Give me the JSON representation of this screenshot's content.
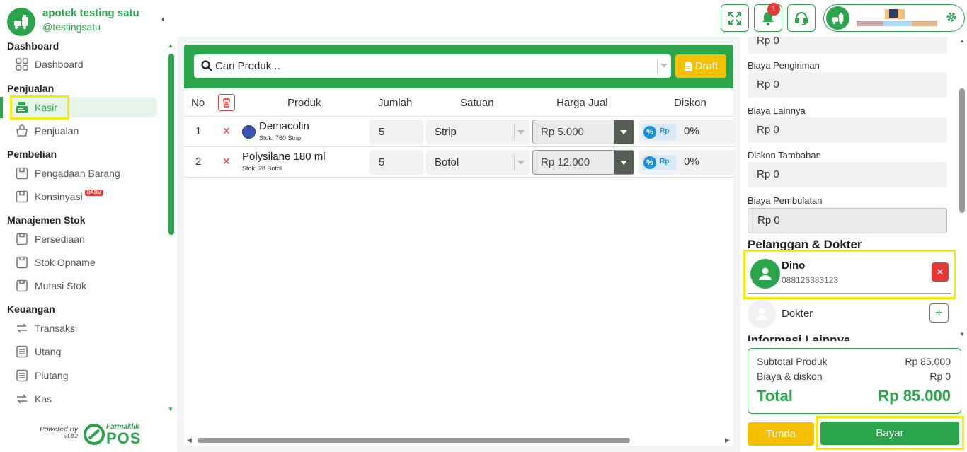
{
  "brand": {
    "name": "apotek testing satu",
    "handle": "@testingsatu"
  },
  "sidebar": {
    "sections": [
      {
        "title": "Dashboard",
        "items": [
          {
            "label": "Dashboard",
            "icon": "grid-icon"
          }
        ]
      },
      {
        "title": "Penjualan",
        "items": [
          {
            "label": "Kasir",
            "icon": "cash-register-icon",
            "active": true
          },
          {
            "label": "Penjualan",
            "icon": "basket-icon"
          }
        ]
      },
      {
        "title": "Pembelian",
        "items": [
          {
            "label": "Pengadaan Barang",
            "icon": "box-icon"
          },
          {
            "label": "Konsinyasi",
            "icon": "box-icon",
            "badge": "BARU"
          }
        ]
      },
      {
        "title": "Manajemen Stok",
        "items": [
          {
            "label": "Persediaan",
            "icon": "clipboard-icon"
          },
          {
            "label": "Stok Opname",
            "icon": "clipboard-icon"
          },
          {
            "label": "Mutasi Stok",
            "icon": "clipboard-icon"
          }
        ]
      },
      {
        "title": "Keuangan",
        "items": [
          {
            "label": "Transaksi",
            "icon": "exchange-icon"
          },
          {
            "label": "Utang",
            "icon": "ledger-icon"
          },
          {
            "label": "Piutang",
            "icon": "ledger-icon"
          },
          {
            "label": "Kas",
            "icon": "exchange-icon"
          }
        ]
      }
    ]
  },
  "powered": {
    "label": "Powered By",
    "version": "v1.8.2",
    "logo_small": "Farmaklik",
    "logo_big": "POS"
  },
  "topbar": {
    "notification_count": "1"
  },
  "search": {
    "placeholder": "Cari Produk...",
    "draft_label": "Draft"
  },
  "table": {
    "headers": {
      "no": "No",
      "product": "Produk",
      "qty": "Jumlah",
      "unit": "Satuan",
      "price": "Harga Jual",
      "discount": "Diskon"
    },
    "rows": [
      {
        "no": "1",
        "name": "Demacolin",
        "stock": "Stok: 760 Strip",
        "qty": "5",
        "unit": "Strip",
        "price": "Rp 5.000",
        "discount": "0%",
        "toggle_pct": "%",
        "toggle_rp": "Rp"
      },
      {
        "no": "2",
        "name": "Polysilane 180 ml",
        "stock": "Stok: 28 Botol",
        "qty": "5",
        "unit": "Botol",
        "price": "Rp 12.000",
        "discount": "0%",
        "toggle_pct": "%",
        "toggle_rp": "Rp"
      }
    ]
  },
  "costs": {
    "top_value": "Rp 0",
    "shipping": {
      "label": "Biaya Pengiriman",
      "value": "Rp 0"
    },
    "other": {
      "label": "Biaya Lainnya",
      "value": "Rp 0"
    },
    "extra_discount": {
      "label": "Diskon Tambahan",
      "value": "Rp 0"
    },
    "rounding": {
      "label": "Biaya Pembulatan",
      "value": "Rp 0"
    }
  },
  "customer_section": {
    "title": "Pelanggan & Dokter",
    "customer_name": "Dino",
    "customer_phone": "088126383123",
    "doctor_label": "Dokter"
  },
  "other_info_title": "Informasi Lainnya",
  "summary": {
    "subtotal_label": "Subtotal Produk",
    "subtotal_value": "Rp 85.000",
    "fees_label": "Biaya & diskon",
    "fees_value": "Rp 0",
    "total_label": "Total",
    "total_value": "Rp 85.000"
  },
  "actions": {
    "hold_label": "Tunda",
    "pay_label": "Bayar"
  },
  "colors": {
    "primary": "#2aa54b",
    "warning": "#f5c000",
    "danger": "#e53935",
    "highlight": "#f5ea0a"
  }
}
